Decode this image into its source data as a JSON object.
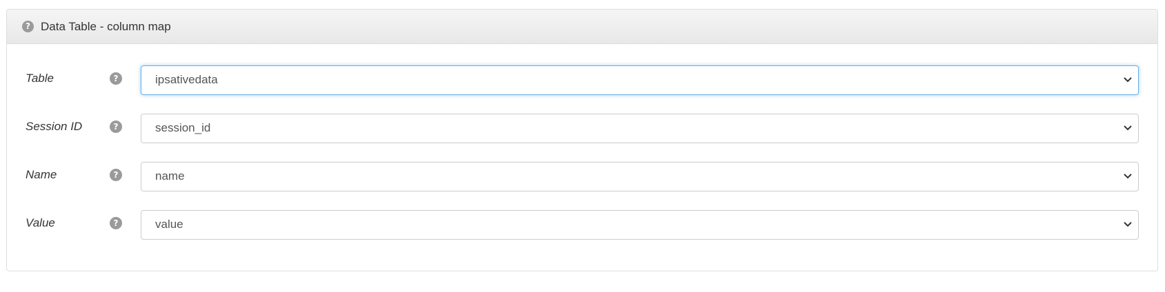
{
  "panel": {
    "title": "Data Table - column map",
    "help_icon_glyph": "?"
  },
  "fields": [
    {
      "label": "Table",
      "value": "ipsativedata"
    },
    {
      "label": "Session ID",
      "value": "session_id"
    },
    {
      "label": "Name",
      "value": "name"
    },
    {
      "label": "Value",
      "value": "value"
    }
  ],
  "colors": {
    "focus_border": "#66afe9",
    "help_icon": "#9a9a9a"
  }
}
